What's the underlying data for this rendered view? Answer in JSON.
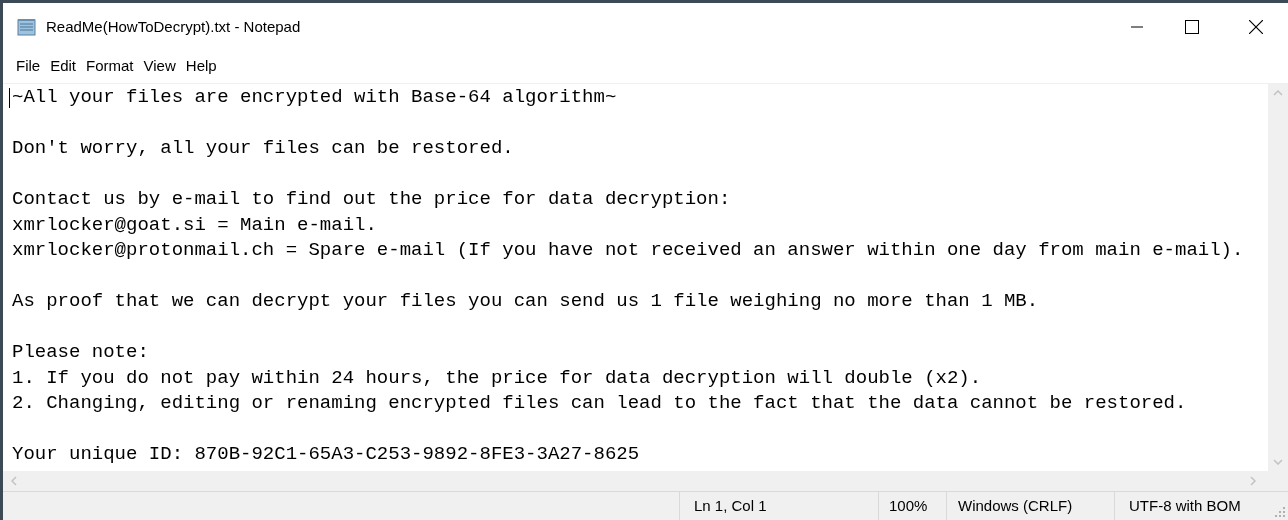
{
  "window": {
    "title": "ReadMe(HowToDecrypt).txt - Notepad"
  },
  "menu": [
    "File",
    "Edit",
    "Format",
    "View",
    "Help"
  ],
  "document": {
    "paragraphs": [
      [
        "~All your files are encrypted with Base-64 algorithm~"
      ],
      [
        "Don't worry, all your files can be restored."
      ],
      [
        "Contact us by e-mail to find out the price for data decryption:",
        "xmrlocker@goat.si = Main e-mail.",
        "xmrlocker@protonmail.ch = Spare e-mail (If you have not received an answer within one day from main e-mail)."
      ],
      [
        "As proof that we can decrypt your files you can send us 1 file weighing no more than 1 MB."
      ],
      [
        "Please note:",
        "1. If you do not pay within 24 hours, the price for data decryption will double (x2).",
        "2. Changing, editing or renaming encrypted files can lead to the fact that the data cannot be restored."
      ],
      [
        "Your unique ID: 870B-92C1-65A3-C253-9892-8FE3-3A27-8625"
      ]
    ]
  },
  "status_bar": {
    "position": "Ln 1, Col 1",
    "zoom": "100%",
    "line_endings": "Windows (CRLF)",
    "encoding": "UTF-8 with BOM"
  }
}
